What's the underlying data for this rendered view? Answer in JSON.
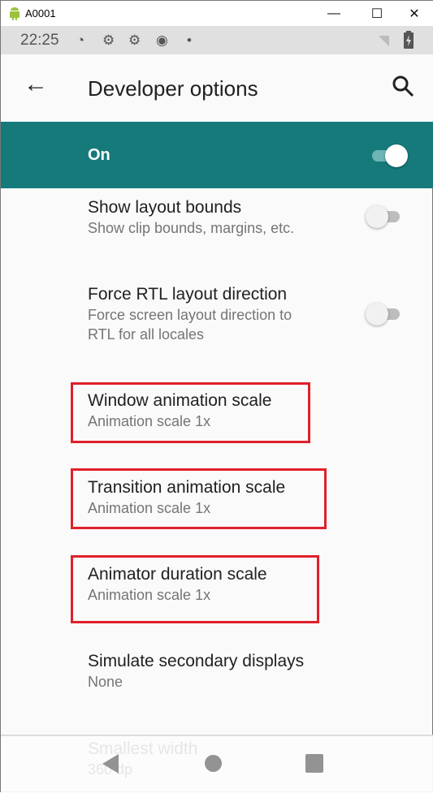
{
  "window": {
    "title": "A0001",
    "minimize": "—",
    "maximize": "☐",
    "close": "✕"
  },
  "status": {
    "time": "22:25",
    "icons": [
      "data-saver-icon",
      "settings-icon",
      "settings-icon",
      "record-icon",
      "dot-icon",
      "wifi-off-icon",
      "battery-charging-icon"
    ]
  },
  "appbar": {
    "title": "Developer options"
  },
  "master": {
    "label": "On",
    "enabled": true
  },
  "items": [
    {
      "title": "Show layout bounds",
      "summary": "Show clip bounds, margins, etc.",
      "toggle": false
    },
    {
      "title": "Force RTL layout direction",
      "summary": "Force screen layout direction to",
      "summary2": "RTL for all locales",
      "toggle": false
    },
    {
      "title": "Window animation scale",
      "summary": "Animation scale 1x"
    },
    {
      "title": "Transition animation scale",
      "summary": "Animation scale 1x"
    },
    {
      "title": "Animator duration scale",
      "summary": "Animation scale 1x"
    },
    {
      "title": "Simulate secondary displays",
      "summary": "None"
    },
    {
      "title": "Smallest width",
      "summary": "360 dp"
    }
  ],
  "colors": {
    "accent": "#167a7b",
    "highlight": "#e0202a"
  }
}
